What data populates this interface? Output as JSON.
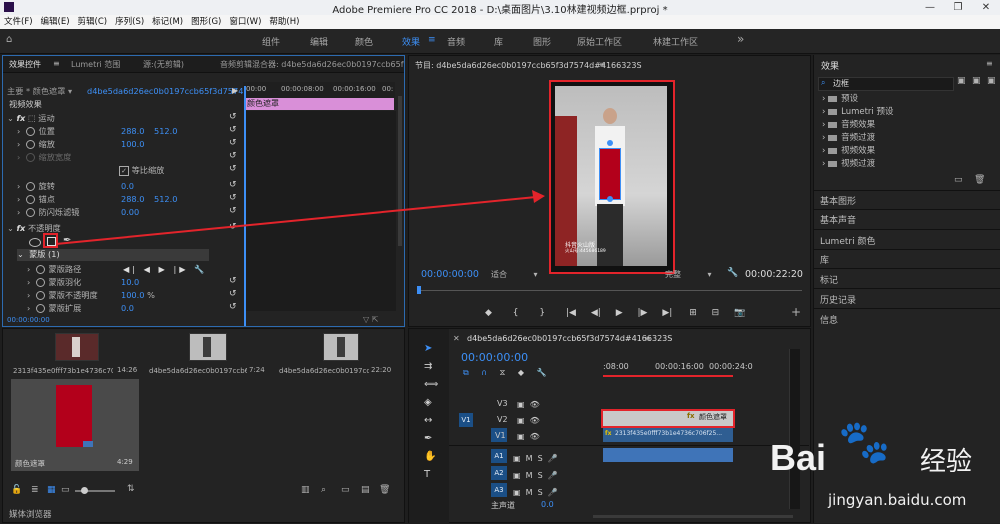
{
  "app": {
    "title": "Adobe Premiere Pro CC 2018 - D:\\桌面图片\\3.10林建视频边框.prproj *"
  },
  "menu": [
    "文件(F)",
    "编辑(E)",
    "剪辑(C)",
    "序列(S)",
    "标记(M)",
    "图形(G)",
    "窗口(W)",
    "帮助(H)"
  ],
  "workspaces": {
    "items": [
      "组件",
      "编辑",
      "颜色",
      "效果",
      "音频",
      "库",
      "图形",
      "原始工作区",
      "林建工作区"
    ],
    "active": "效果",
    "overflow": "»"
  },
  "effect_controls": {
    "tabs": [
      "效果控件",
      "Lumetri 范围",
      "源:(无剪辑)",
      "音频剪辑混合器: d4be5da6d26ec0b0197ccb65f"
    ],
    "master": "主要 * 颜色遮罩",
    "clip": "d4be5da6d26ec0b0197ccb65f3d7574d#...",
    "tl_times": [
      "00:00",
      "00:00:08:00",
      "00:00:16:00",
      "00:"
    ],
    "clip_bar": "颜色遮罩",
    "section": "视频效果",
    "motion": {
      "name": "运动",
      "position": {
        "label": "位置",
        "x": "288.0",
        "y": "512.0"
      },
      "scale": {
        "label": "缩放",
        "value": "100.0"
      },
      "scale_width": {
        "label": "缩放宽度"
      },
      "uniform_scale": "等比缩放",
      "rotation": {
        "label": "旋转",
        "value": "0.0"
      },
      "anchor": {
        "label": "锚点",
        "x": "288.0",
        "y": "512.0"
      },
      "flicker": {
        "label": "防闪烁滤镜",
        "value": "0.00"
      }
    },
    "opacity": {
      "name": "不透明度",
      "mask": "蒙版 (1)",
      "mask_path": "蒙版路径",
      "feather": {
        "label": "蒙版羽化",
        "value": "10.0"
      },
      "mask_opacity": {
        "label": "蒙版不透明度",
        "value": "100.0",
        "unit": "%"
      },
      "expansion": {
        "label": "蒙版扩展",
        "value": "0.0"
      }
    },
    "footer_time": "00:00:00:00"
  },
  "project": {
    "items": [
      {
        "name": "2313f435e0fff73b1e4736c706...",
        "duration": "14:26"
      },
      {
        "name": "d4be5da6d26ec0b0197ccb65...",
        "duration": "7:24"
      },
      {
        "name": "d4be5da6d26ec0b0197ccb65...",
        "duration": "22:20"
      },
      {
        "name": "颜色遮罩",
        "duration": "4:29"
      }
    ],
    "bottom_tab": "媒体浏览器"
  },
  "program": {
    "title": "节目: d4be5da6d26ec0b0197ccb65f3d7574d#4166323S",
    "timecode": "00:00:00:00",
    "fit": "适合",
    "quality": "完整",
    "duration": "00:00:22:20",
    "watermark": "抖音火山版",
    "watermark_id": "火山号:445686189"
  },
  "timeline": {
    "title": "d4be5da6d26ec0b0197ccb65f3d7574d#4166323S",
    "timecode": "00:00:00:00",
    "ruler": [
      ":08:00",
      "00:00:16:00",
      "00:00:24:0"
    ],
    "v_tracks": [
      "V3",
      "V2",
      "V1"
    ],
    "a_tracks": [
      "A1",
      "A2",
      "A3"
    ],
    "source_v": "V1",
    "source_a": "A1",
    "master": "主声道",
    "master_value": "0.0",
    "clip_v2": "颜色遮罩",
    "clip_v1": "2313f435e0fff73b1e4736c706f25..."
  },
  "effects_panel": {
    "title": "效果",
    "search": "边框",
    "folders": [
      "预设",
      "Lumetri 预设",
      "音频效果",
      "音频过渡",
      "视频效果",
      "视频过渡"
    ],
    "sections": [
      "基本图形",
      "基本声音",
      "Lumetri 颜色",
      "库",
      "标记",
      "历史记录",
      "信息"
    ]
  },
  "watermark": {
    "text": "Bai",
    "suffix": "经验",
    "url": "jingyan.baidu.com"
  },
  "colors": {
    "accent_blue": "#2d8cf0",
    "highlight_red": "#e3242b",
    "mask_red": "#b3001b",
    "pink_clip": "#d98fd8",
    "audio_clip": "#3f74b8"
  }
}
